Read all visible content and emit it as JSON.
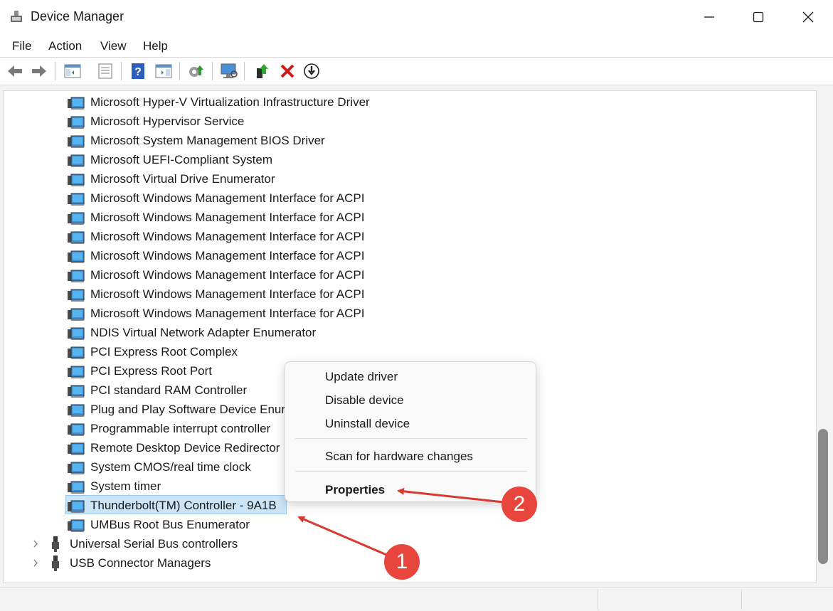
{
  "window": {
    "title": "Device Manager"
  },
  "menu": [
    "File",
    "Action",
    "View",
    "Help"
  ],
  "toolbar_icons": [
    "back-icon",
    "forward-icon",
    "show-hide-console-tree-icon",
    "properties-sheet-icon",
    "help-icon",
    "action-pane-icon",
    "update-driver-icon",
    "scan-hardware-icon",
    "enable-device-icon",
    "uninstall-device-icon",
    "disable-device-icon"
  ],
  "tree": {
    "devices": [
      "Microsoft Hyper-V Virtualization Infrastructure Driver",
      "Microsoft Hypervisor Service",
      "Microsoft System Management BIOS Driver",
      "Microsoft UEFI-Compliant System",
      "Microsoft Virtual Drive Enumerator",
      "Microsoft Windows Management Interface for ACPI",
      "Microsoft Windows Management Interface for ACPI",
      "Microsoft Windows Management Interface for ACPI",
      "Microsoft Windows Management Interface for ACPI",
      "Microsoft Windows Management Interface for ACPI",
      "Microsoft Windows Management Interface for ACPI",
      "Microsoft Windows Management Interface for ACPI",
      "NDIS Virtual Network Adapter Enumerator",
      "PCI Express Root Complex",
      "PCI Express Root Port",
      "PCI standard RAM Controller",
      "Plug and Play Software Device Enur",
      "Programmable interrupt controller",
      "Remote Desktop Device Redirector",
      "System CMOS/real time clock",
      "System timer",
      "Thunderbolt(TM) Controller - 9A1B",
      "UMBus Root Bus Enumerator"
    ],
    "selected_index": 21,
    "categories": [
      "Universal Serial Bus controllers",
      "USB Connector Managers"
    ]
  },
  "context_menu": {
    "items": [
      "Update driver",
      "Disable device",
      "Uninstall device",
      "Scan for hardware changes",
      "Properties"
    ]
  },
  "annotations": {
    "badge_1": "1",
    "badge_2": "2"
  },
  "colors": {
    "annotation_red": "#e8463c",
    "selection": "#cce4f7"
  }
}
